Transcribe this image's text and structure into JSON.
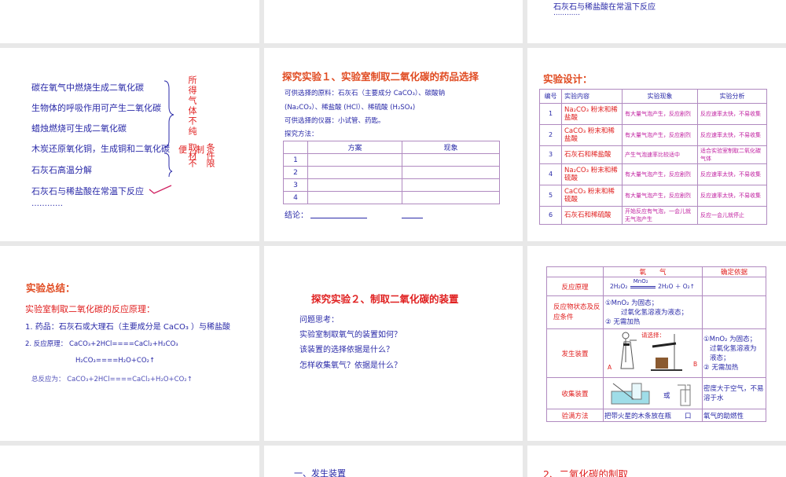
{
  "slide_top_right": {
    "line": "石灰石与稀盐酸在常温下反应",
    "ellipsis": "…………"
  },
  "slide_methods": {
    "items": [
      "碳在氧气中燃烧生成二氧化碳",
      "生物体的呼吸作用可产生二氧化碳",
      "蜡烛燃烧可生成二氧化碳",
      "木炭还原氧化铜，生成铜和二氧化碳",
      "石灰石高温分解",
      "石灰石与稀盐酸在常温下反应",
      "…………"
    ],
    "note_impure": "所得气体不纯",
    "note_inconvenient": "便",
    "note_material": "取材不",
    "note_limit_a": "制",
    "note_limit_b": "条件限"
  },
  "slide_exp1": {
    "title": "探究实验１、实验室制取二氧化碳的药品选择",
    "line1": "可供选择的原料：石灰石（主要成分 CaCO₃）、碳酸钠",
    "line2": "(Na₂CO₃）、稀盐酸 (HCl）、稀硫酸 (H₂SO₄)",
    "line3": "可供选择的仪器：小试管、药匙。",
    "line4": "探究方法：",
    "headers": [
      "",
      "方案",
      "现象"
    ],
    "rows": [
      "1",
      "2",
      "3",
      "4"
    ],
    "conclusion": "结论："
  },
  "slide_design": {
    "title": "实验设计：",
    "headers": [
      "编号",
      "实验内容",
      "实验现象",
      "实验分析"
    ],
    "rows": [
      [
        "1",
        "Na₂CO₃ 粉末和稀盐酸",
        "有大量气泡产生，反应剧烈",
        "反应速率太快，不易收集"
      ],
      [
        "2",
        "CaCO₃ 粉末和稀盐酸",
        "有大量气泡产生，反应剧烈",
        "反应速率太快，不易收集"
      ],
      [
        "3",
        "石灰石和稀盐酸",
        "产生气泡速率比较适中",
        "适合实验室制取二氧化碳气体"
      ],
      [
        "4",
        "Na₂CO₃ 粉末和稀硫酸",
        "有大量气泡产生，反应剧烈",
        "反应速率太快，不易收集"
      ],
      [
        "5",
        "CaCO₃ 粉末和稀硫酸",
        "有大量气泡产生，反应剧烈",
        "反应速率太快，不易收集"
      ],
      [
        "6",
        "石灰石和稀硫酸",
        "开始反应有气泡，一会儿就无气泡产生",
        "反应一会儿就停止"
      ]
    ]
  },
  "slide_summary": {
    "title": "实验总结：",
    "subtitle": "实验室制取二氧化碳的反应原理：",
    "line1": "1. 药品：石灰石或大理石（主要成分是 CaCO₃ ）与稀盐酸",
    "line2": "2. 反应原理： CaCO₃+2HCl====CaCl₂+H₂CO₃",
    "line3": "H₂CO₃====H₂O+CO₂↑",
    "line4": "总反应为： CaCO₃+2HCl====CaCl₂+H₂O+CO₂↑"
  },
  "slide_exp2": {
    "title": "探究实验２、制取二氧化碳的装置",
    "lines": [
      "问题思考：",
      "实验室制取氧气的装置如何？",
      "该装置的选择依据是什么？",
      "怎样收集氧气？依据是什么？"
    ]
  },
  "slide_oxygen": {
    "headers": [
      "",
      "氧　　气",
      "确定依据"
    ],
    "row_principle": {
      "label": "反应原理",
      "catalyst": "MnO₂",
      "eq_left": "2H₂O₂",
      "eq_right": "2H₂O ＋ O₂↑"
    },
    "row_state": {
      "label": "反应物状态及反应条件",
      "lines": [
        "①MnO₂ 为固态；",
        "过氧化氢溶液为液态；",
        "② 无需加热"
      ]
    },
    "row_apparatus": {
      "label": "发生装置",
      "prompt": "请选择：",
      "a": "A",
      "b": "B",
      "basis": [
        "①MnO₂ 为固态；",
        "过氧化氢溶液为",
        "液态；",
        "② 无需加热"
      ]
    },
    "row_collect": {
      "label": "收集装置",
      "or": "或",
      "basis": "密度大于空气，不易溶于水"
    },
    "row_check": {
      "label": "验满方法",
      "method": "把带火星的木条放在瓶　　口",
      "basis": "氧气的助燃性"
    }
  },
  "slide_bottom_mid": {
    "title": "一、发生装置"
  },
  "slide_bottom_right": {
    "title": "2、二氧化碳的制取"
  }
}
